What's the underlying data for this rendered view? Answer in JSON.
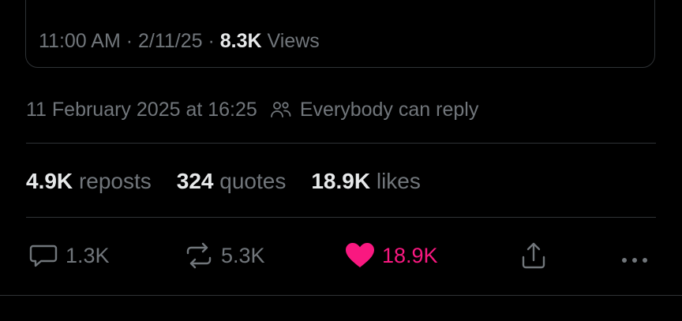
{
  "quote": {
    "time": "11:00 AM",
    "date": "2/11/25",
    "views_count": "8.3K",
    "views_label": "Views"
  },
  "post": {
    "timestamp": "11 February 2025 at 16:25",
    "reply_setting": "Everybody can reply"
  },
  "stats": {
    "reposts_count": "4.9K",
    "reposts_label": "reposts",
    "quotes_count": "324",
    "quotes_label": "quotes",
    "likes_count": "18.9K",
    "likes_label": "likes"
  },
  "actions": {
    "reply_count": "1.3K",
    "repost_count": "5.3K",
    "like_count": "18.9K"
  },
  "colors": {
    "background": "#000000",
    "text": "#e7e9ea",
    "muted": "#71767b",
    "border": "#2f3336",
    "like": "#f91880"
  },
  "icons": [
    "people-icon",
    "reply-icon",
    "repost-icon",
    "heart-icon",
    "share-icon",
    "more-icon"
  ]
}
